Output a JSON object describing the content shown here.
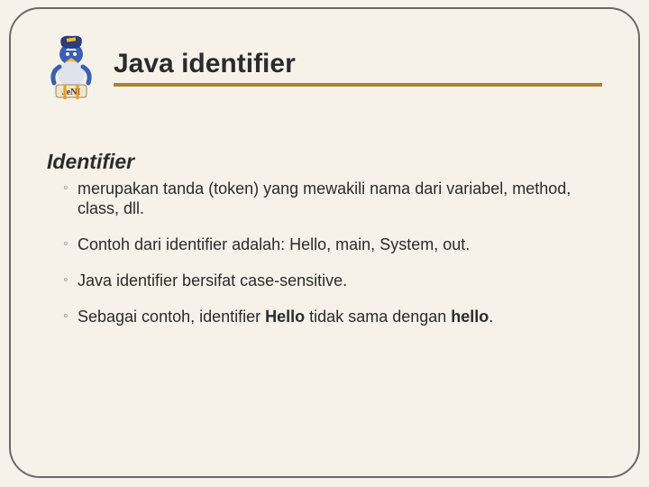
{
  "logo": {
    "alt": "JeNI mascot logo",
    "text": "JeNI"
  },
  "title": "Java identifier",
  "section_heading": "Identifier",
  "bullets": [
    {
      "html": "merupakan tanda (token) yang mewakili nama dari variabel, method, class, dll."
    },
    {
      "html": "Contoh dari identifier adalah: Hello, main, System, out."
    },
    {
      "html": "Java identifier bersifat case-sensitive."
    },
    {
      "html": "Sebagai contoh, identifier <span class=\"bold\">Hello</span> tidak sama dengan <span class=\"bold\">hello</span>."
    }
  ]
}
